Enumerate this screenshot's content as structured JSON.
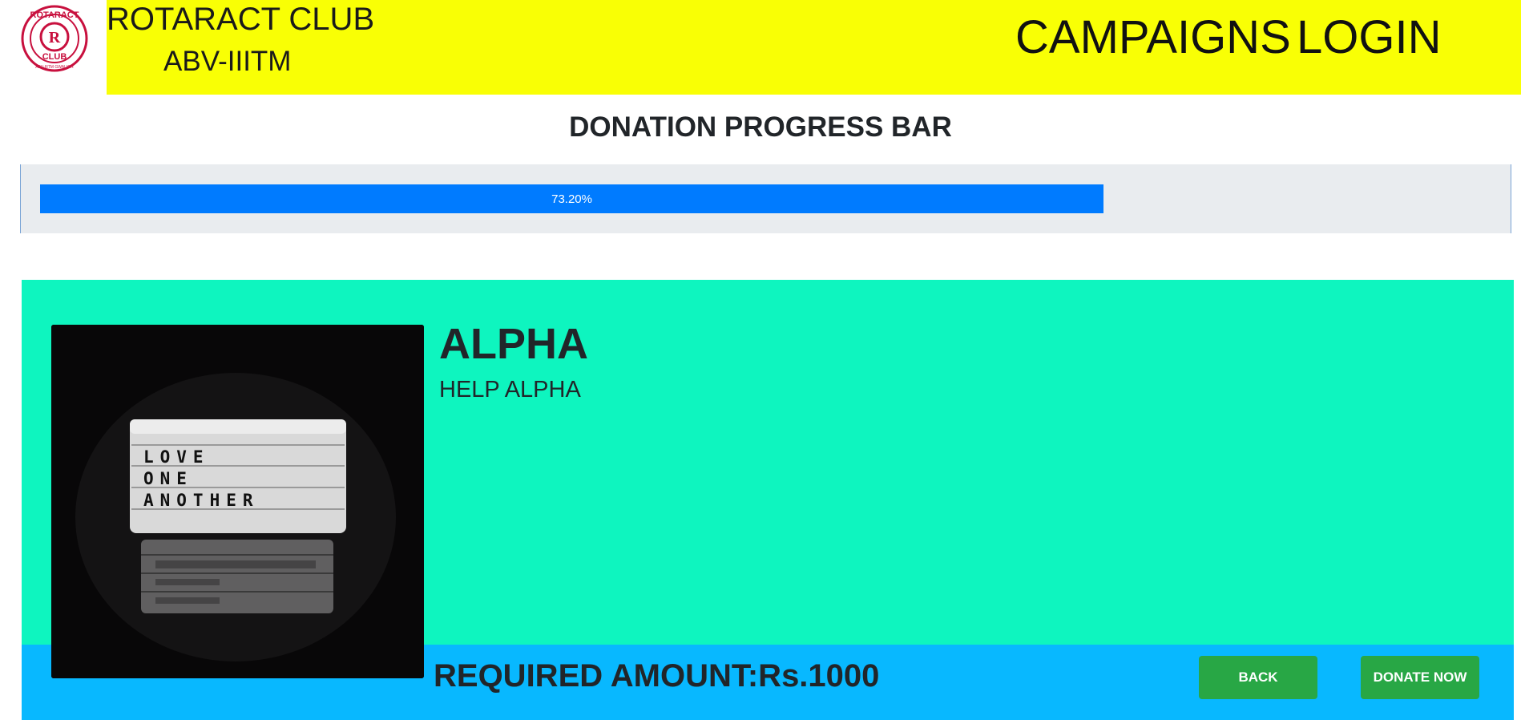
{
  "header": {
    "club_name": "ROTARACT CLUB",
    "club_sub": "ABV-IIITM",
    "logo": {
      "top_text": "ROTARACT",
      "letter": "R",
      "bottom_text": "CLUB",
      "ring_text": "ABV-IIITM GWALIOR"
    },
    "nav": {
      "campaigns": "CAMPAIGNS",
      "login": "LOGIN"
    },
    "band_color": "#f9ff05"
  },
  "progress": {
    "title": "DONATION PROGRESS BAR",
    "value_percent": 73.2,
    "label": "73.20%",
    "fill_color": "#007bff"
  },
  "campaign": {
    "title": "ALPHA",
    "description": "HELP ALPHA",
    "image": {
      "lines": [
        "LOVE",
        "ONE",
        "ANOTHER"
      ]
    },
    "required_amount": "REQUIRED AMOUNT:Rs.1000",
    "card_color": "#0ef5bf",
    "footer_color": "#08b8ff"
  },
  "actions": {
    "back": "BACK",
    "donate": "DONATE NOW"
  }
}
